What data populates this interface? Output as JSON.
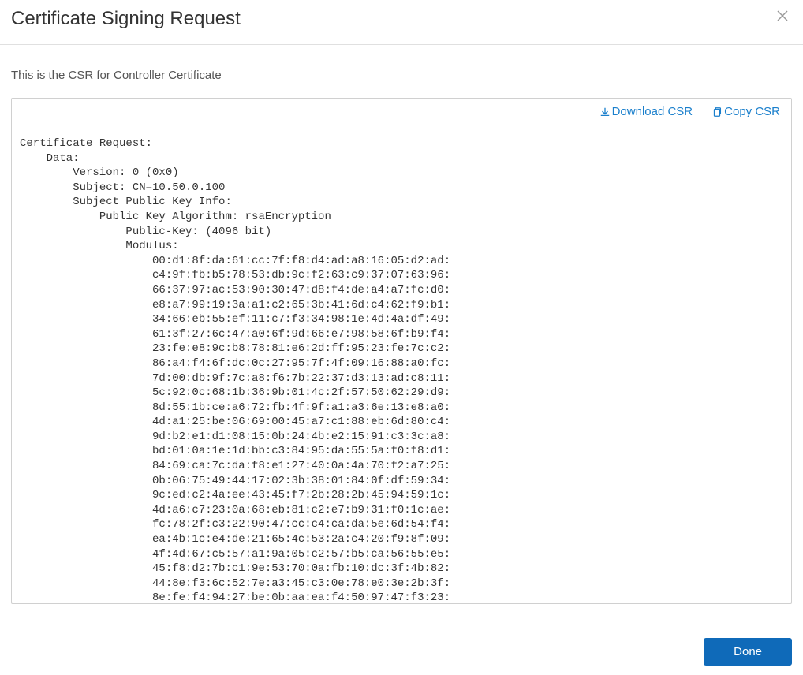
{
  "dialog": {
    "title": "Certificate Signing Request",
    "description": "This is the CSR for Controller Certificate"
  },
  "toolbar": {
    "download_label": "Download CSR",
    "copy_label": "Copy CSR"
  },
  "footer": {
    "done_label": "Done"
  },
  "csr_text": "Certificate Request:\n    Data:\n        Version: 0 (0x0)\n        Subject: CN=10.50.0.100\n        Subject Public Key Info:\n            Public Key Algorithm: rsaEncryption\n                Public-Key: (4096 bit)\n                Modulus:\n                    00:d1:8f:da:61:cc:7f:f8:d4:ad:a8:16:05:d2:ad:\n                    c4:9f:fb:b5:78:53:db:9c:f2:63:c9:37:07:63:96:\n                    66:37:97:ac:53:90:30:47:d8:f4:de:a4:a7:fc:d0:\n                    e8:a7:99:19:3a:a1:c2:65:3b:41:6d:c4:62:f9:b1:\n                    34:66:eb:55:ef:11:c7:f3:34:98:1e:4d:4a:df:49:\n                    61:3f:27:6c:47:a0:6f:9d:66:e7:98:58:6f:b9:f4:\n                    23:fe:e8:9c:b8:78:81:e6:2d:ff:95:23:fe:7c:c2:\n                    86:a4:f4:6f:dc:0c:27:95:7f:4f:09:16:88:a0:fc:\n                    7d:00:db:9f:7c:a8:f6:7b:22:37:d3:13:ad:c8:11:\n                    5c:92:0c:68:1b:36:9b:01:4c:2f:57:50:62:29:d9:\n                    8d:55:1b:ce:a6:72:fb:4f:9f:a1:a3:6e:13:e8:a0:\n                    4d:a1:25:be:06:69:00:45:a7:c1:88:eb:6d:80:c4:\n                    9d:b2:e1:d1:08:15:0b:24:4b:e2:15:91:c3:3c:a8:\n                    bd:01:0a:1e:1d:bb:c3:84:95:da:55:5a:f0:f8:d1:\n                    84:69:ca:7c:da:f8:e1:27:40:0a:4a:70:f2:a7:25:\n                    0b:06:75:49:44:17:02:3b:38:01:84:0f:df:59:34:\n                    9c:ed:c2:4a:ee:43:45:f7:2b:28:2b:45:94:59:1c:\n                    4d:a6:c7:23:0a:68:eb:81:c2:e7:b9:31:f0:1c:ae:\n                    fc:78:2f:c3:22:90:47:cc:c4:ca:da:5e:6d:54:f4:\n                    ea:4b:1c:e4:de:21:65:4c:53:2a:c4:20:f9:8f:09:\n                    4f:4d:67:c5:57:a1:9a:05:c2:57:b5:ca:56:55:e5:\n                    45:f8:d2:7b:c1:9e:53:70:0a:fb:10:dc:3f:4b:82:\n                    44:8e:f3:6c:52:7e:a3:45:c3:0e:78:e0:3e:2b:3f:\n                    8e:fe:f4:94:27:be:0b:aa:ea:f4:50:97:47:f3:23:"
}
